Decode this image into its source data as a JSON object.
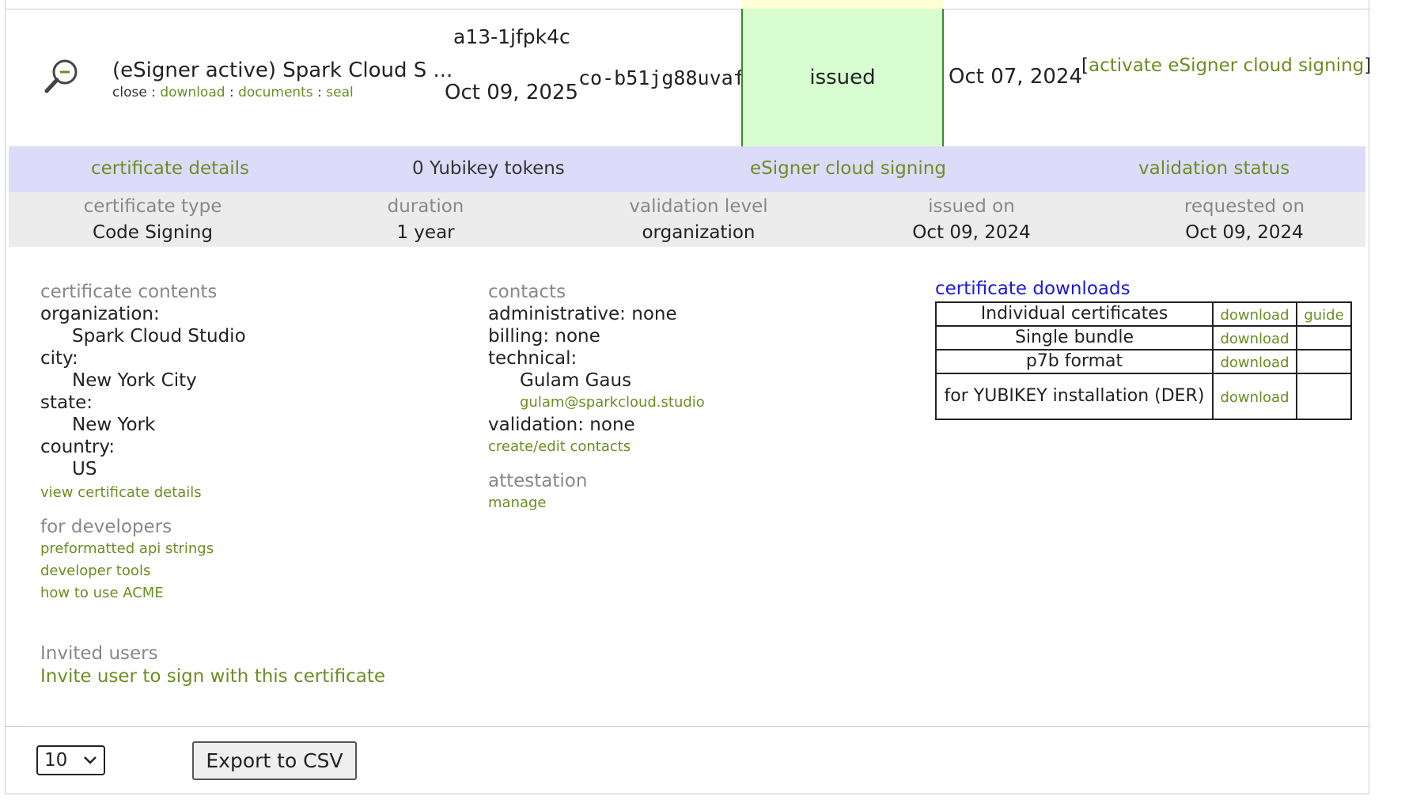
{
  "row": {
    "title": "(eSigner active) Spark Cloud S ...",
    "sub_prefix": "close :",
    "sub_links": [
      "download",
      "documents",
      "seal"
    ],
    "sub_sep": ":",
    "order_number": "a13-1jfpk4c",
    "expires": "Oct 09, 2025",
    "code": "co-b51jg88uvaf",
    "status": "issued",
    "issued_date": "Oct 07, 2024",
    "activate_open": "[",
    "activate_link": "activate eSigner cloud signing",
    "activate_close": "]"
  },
  "tabs": {
    "certificate_details": "certificate details",
    "yubikey": "0 Yubikey tokens",
    "esigner": "eSigner cloud signing",
    "validation_status": "validation status"
  },
  "summary": [
    {
      "header": "certificate type",
      "value": "Code Signing"
    },
    {
      "header": "duration",
      "value": "1 year"
    },
    {
      "header": "validation level",
      "value": "organization"
    },
    {
      "header": "issued on",
      "value": "Oct 09, 2024"
    },
    {
      "header": "requested on",
      "value": "Oct 09, 2024"
    }
  ],
  "contents": {
    "heading": "certificate contents",
    "org_label": "organization:",
    "org_value": "Spark Cloud Studio",
    "city_label": "city:",
    "city_value": "New York City",
    "state_label": "state:",
    "state_value": "New York",
    "country_label": "country:",
    "country_value": "US",
    "view_link": "view certificate details"
  },
  "developers": {
    "heading": "for developers",
    "links": [
      "preformatted api strings",
      "developer tools",
      "how to use ACME"
    ]
  },
  "contacts": {
    "heading": "contacts",
    "administrative": "administrative: none",
    "billing": "billing: none",
    "technical_label": "technical:",
    "technical_name": "Gulam Gaus",
    "technical_email": "gulam@sparkcloud.studio",
    "validation": "validation: none",
    "edit_link": "create/edit contacts"
  },
  "attestation": {
    "heading": "attestation",
    "manage_link": "manage"
  },
  "downloads": {
    "heading": "certificate downloads",
    "rows": [
      {
        "name": "Individual certificates",
        "action": "download",
        "guide": "guide"
      },
      {
        "name": "Single bundle",
        "action": "download",
        "guide": ""
      },
      {
        "name": "p7b format",
        "action": "download",
        "guide": ""
      },
      {
        "name": "for YUBIKEY installation (DER)",
        "action": "download",
        "guide": ""
      }
    ]
  },
  "invited": {
    "heading": "Invited users",
    "invite_link": "Invite user to sign with this certificate"
  },
  "footer": {
    "page_size": "10",
    "export_label": "Export to CSV"
  }
}
